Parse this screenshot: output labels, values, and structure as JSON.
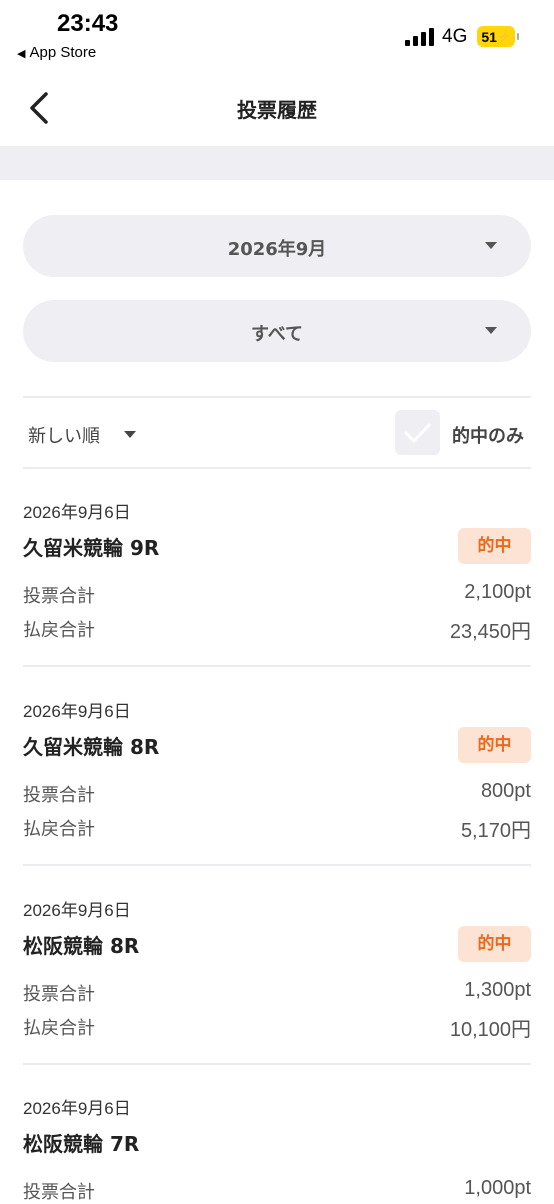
{
  "status": {
    "time": "23:43",
    "back_app": "App Store",
    "network": "4G",
    "battery": "51"
  },
  "nav": {
    "title": "投票履歴"
  },
  "filters": {
    "month": "2026年9月",
    "category": "すべて"
  },
  "sort": {
    "label": "新しい順"
  },
  "hit_only": {
    "label": "的中のみ",
    "checked": false
  },
  "labels": {
    "bet_total": "投票合計",
    "payout_total": "払戻合計"
  },
  "items": [
    {
      "date": "2026年9月6日",
      "race": "久留米競輪 9R",
      "badge": "的中",
      "bet": "2,100pt",
      "payout": "23,450円"
    },
    {
      "date": "2026年9月6日",
      "race": "久留米競輪 8R",
      "badge": "的中",
      "bet": "800pt",
      "payout": "5,170円"
    },
    {
      "date": "2026年9月6日",
      "race": "松阪競輪 8R",
      "badge": "的中",
      "bet": "1,300pt",
      "payout": "10,100円"
    },
    {
      "date": "2026年9月6日",
      "race": "松阪競輪 7R",
      "bet": "1,000pt"
    }
  ],
  "colors": {
    "accent": "#ec6a1d",
    "badge_bg": "#fde3d3",
    "control_bg": "#efeff3"
  }
}
